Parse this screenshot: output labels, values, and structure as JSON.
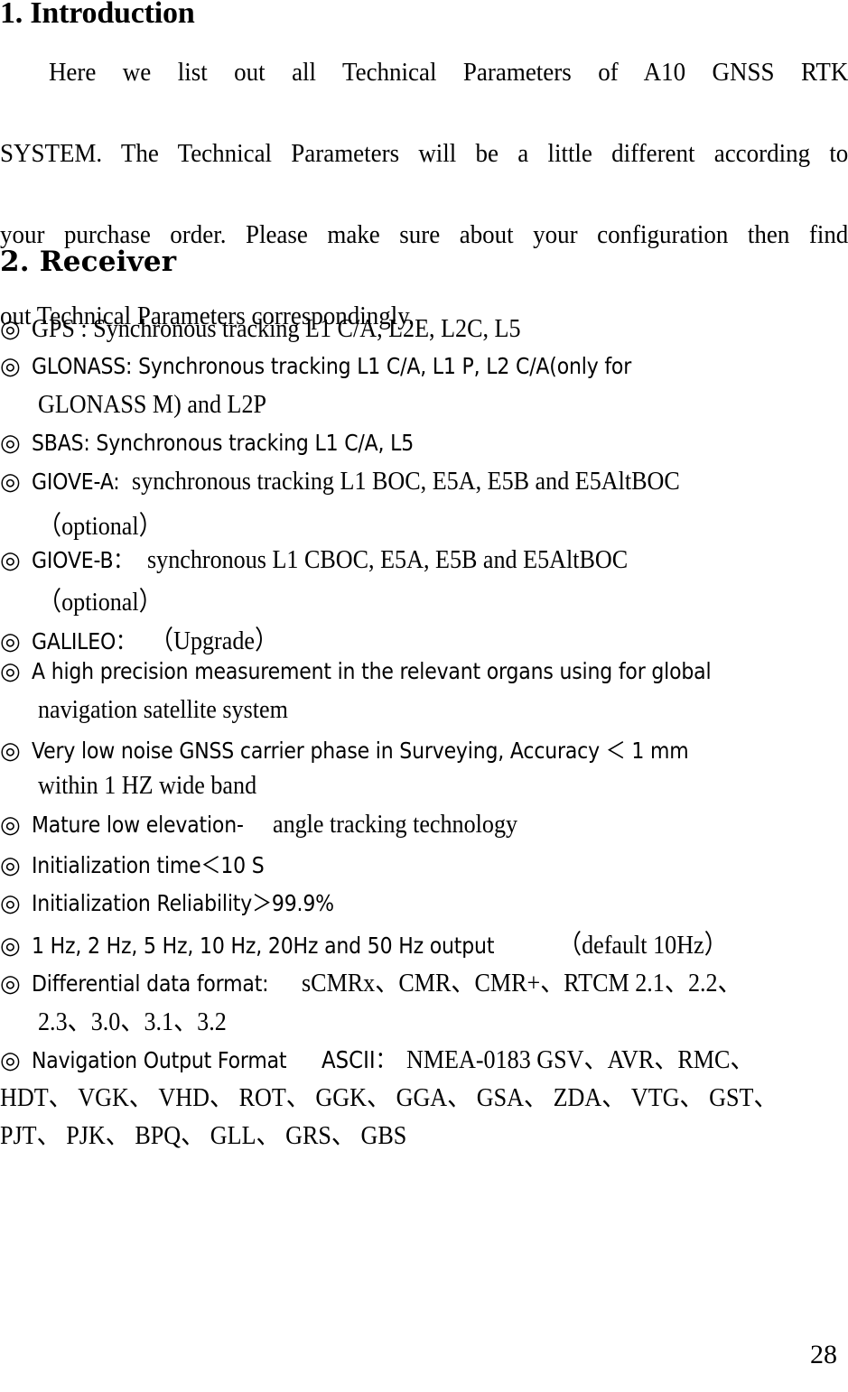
{
  "document": {
    "page_number": "28",
    "sections": [
      {
        "heading": "1. Introduction",
        "paragraph": "Here we list out all Technical Parameters of A10 GNSS RTK SYSTEM. The Technical Parameters will be a little different according to your purchase order. Please make sure about your configuration then find out Technical Parameters correspondingly.",
        "paragraph_lines": [
          "Here we list out all Technical Parameters of A10 GNSS RTK",
          "SYSTEM. The Technical Parameters will be a little different according to",
          "your purchase order. Please make sure about your configuration then find",
          "out Technical Parameters correspondingly."
        ]
      },
      {
        "heading": "2. Receiver",
        "bullet_symbol": "◎",
        "items": [
          {
            "id": "gps",
            "text": "GPS : Synchronous tracking L1 C/A, L2E, L2C, L5",
            "lines": [
              {
                "runs": [
                  {
                    "t": "◎",
                    "f": "bullet"
                  },
                  {
                    "t": "GPS : Synchronous tracking L1 C/A, L2E, L2C, L5",
                    "f": "serif"
                  }
                ]
              }
            ]
          },
          {
            "id": "glonass",
            "text": "GLONASS: Synchronous tracking L1 C/A, L1 P, L2 C/A(only for GLONASS M) and L2P",
            "lines": [
              {
                "runs": [
                  {
                    "t": "◎",
                    "f": "bullet"
                  },
                  {
                    "t": "GLONASS:  Synchronous  tracking  L1  C/A,  L1  P,  L2  C/A(only  for",
                    "f": "gothic"
                  }
                ]
              },
              {
                "runs": [
                  {
                    "t": "GLONASS M) and L2P",
                    "f": "serif"
                  }
                ],
                "indent": true
              }
            ]
          },
          {
            "id": "sbas",
            "text": "SBAS:  Synchronous tracking L1 C/A, L5",
            "lines": [
              {
                "runs": [
                  {
                    "t": "◎",
                    "f": "bullet"
                  },
                  {
                    "t": "SBAS:   Synchronous tracking L1 C/A, L5",
                    "f": "gothic"
                  }
                ]
              }
            ]
          },
          {
            "id": "giove-a",
            "text": "GIOVE-A: synchronous tracking  L1 BOC, E5A, E5B and E5AltBOC （optional）",
            "lines": [
              {
                "runs": [
                  {
                    "t": "◎",
                    "f": "bullet"
                  },
                  {
                    "t": "GIOVE-A:",
                    "f": "gothic"
                  },
                  {
                    "t": " synchronous tracking   L1 BOC, E5A, E5B and E5AltBOC",
                    "f": "serif"
                  }
                ]
              },
              {
                "runs": [
                  {
                    "t": "（optional）",
                    "f": "serif"
                  }
                ],
                "indent": true
              }
            ]
          },
          {
            "id": "giove-b",
            "text": "GIOVE-B： synchronous L1 CBOC, E5A, E5B and E5AltBOC （optional）",
            "lines": [
              {
                "runs": [
                  {
                    "t": "◎",
                    "f": "bullet"
                  },
                  {
                    "t": "GIOVE-B：",
                    "f": "gothic"
                  },
                  {
                    "t": "synchronous   L1   CBOC,   E5A,   E5B   and   E5AltBOC",
                    "f": "serif"
                  }
                ]
              },
              {
                "runs": [
                  {
                    "t": "（optional）",
                    "f": "serif"
                  }
                ],
                "indent": true
              }
            ]
          },
          {
            "id": "galileo",
            "text": "GALILEO：（Upgrade）",
            "lines": [
              {
                "runs": [
                  {
                    "t": "◎",
                    "f": "bullet"
                  },
                  {
                    "t": "GALILEO：",
                    "f": "gothic"
                  },
                  {
                    "t": "（Upgrade）",
                    "f": "serif"
                  }
                ]
              }
            ]
          },
          {
            "id": "high-precision",
            "text": "A high precision measurement in the relevant organs using for global navigation satellite system",
            "lines": [
              {
                "runs": [
                  {
                    "t": "◎",
                    "f": "bullet"
                  },
                  {
                    "t": "A  high precision measurement in the relevant organs using for global",
                    "f": "gothic"
                  }
                ]
              },
              {
                "runs": [
                  {
                    "t": "navigation satellite system",
                    "f": "serif"
                  }
                ],
                "indent": true
              }
            ]
          },
          {
            "id": "low-noise",
            "text": "Very low noise GNSS carrier phase in Surveying, Accuracy ＜ 1 mm within 1 HZ wide band",
            "lines": [
              {
                "runs": [
                  {
                    "t": "◎",
                    "f": "bullet"
                  },
                  {
                    "t": "Very low  noise  GNSS  carrier phase in Surveying,  Accuracy ＜ 1  mm",
                    "f": "gothic"
                  }
                ]
              },
              {
                "runs": [
                  {
                    "t": "within 1 HZ wide band",
                    "f": "serif"
                  }
                ],
                "indent": true
              }
            ]
          },
          {
            "id": "mature-tracking",
            "text": "Mature low elevation-angle tracking technology",
            "lines": [
              {
                "runs": [
                  {
                    "t": "◎",
                    "f": "bullet"
                  },
                  {
                    "t": "Mature low elevation-",
                    "f": "gothic"
                  },
                  {
                    "t": "angle tracking technology",
                    "f": "serif"
                  }
                ]
              }
            ]
          },
          {
            "id": "init-time",
            "text": "Initialization time＜10 S",
            "lines": [
              {
                "runs": [
                  {
                    "t": "◎",
                    "f": "bullet"
                  },
                  {
                    "t": "Initialization time＜10 S",
                    "f": "gothic"
                  }
                ]
              }
            ]
          },
          {
            "id": "init-reliability",
            "text": "Initialization Reliability＞99.9%",
            "lines": [
              {
                "runs": [
                  {
                    "t": "◎",
                    "f": "bullet"
                  },
                  {
                    "t": "Initialization Reliability＞99.9%",
                    "f": "gothic"
                  }
                ]
              }
            ]
          },
          {
            "id": "output-rate",
            "text": "1 Hz, 2 Hz, 5 Hz, 10 Hz, 20Hz and 50 Hz output （default 10Hz）",
            "lines": [
              {
                "runs": [
                  {
                    "t": "◎",
                    "f": "bullet"
                  },
                  {
                    "t": "1 Hz, 2 Hz, 5 Hz, 10 Hz, 20Hz and 50 Hz output",
                    "f": "gothic"
                  },
                  {
                    "t": "  （default 10Hz）",
                    "f": "serif"
                  }
                ]
              }
            ]
          },
          {
            "id": "differential-format",
            "text": "Differential data format: sCMRx、CMR、CMR+、RTCM 2.1、2.2、2.3、3.0、3.1、3.2",
            "lines": [
              {
                "runs": [
                  {
                    "t": "◎",
                    "f": "bullet"
                  },
                  {
                    "t": "Differential data format:",
                    "f": "gothic"
                  },
                  {
                    "t": "sCMRx、CMR、CMR+、RTCM 2.1、2.2、",
                    "f": "serif"
                  }
                ]
              },
              {
                "runs": [
                  {
                    "t": "2.3、3.0、3.1、3.2",
                    "f": "serif"
                  }
                ],
                "indent": true
              }
            ]
          },
          {
            "id": "navigation-output",
            "text": "Navigation Output Format  ASCII：NMEA-0183 GSV、AVR、RMC、HDT、VGK、VHD、ROT、GGK、GGA、GSA、ZDA、VTG、GST、PJT、PJK、BPQ、GLL、GRS、GBS",
            "lines": [
              {
                "runs": [
                  {
                    "t": "◎",
                    "f": "bullet"
                  },
                  {
                    "t": "Navigation Output Format",
                    "f": "gothic"
                  },
                  {
                    "t": "   ASCII：",
                    "f": "gothic2"
                  },
                  {
                    "t": "NMEA-0183 GSV、AVR、RMC、",
                    "f": "serif"
                  }
                ]
              },
              {
                "runs": [
                  {
                    "t": "HDT、 VGK、 VHD、 ROT、 GGK、 GGA、 GSA、 ZDA、 VTG、 GST、",
                    "f": "serif"
                  }
                ]
              },
              {
                "runs": [
                  {
                    "t": "PJT、 PJK、 BPQ、 GLL、 GRS、 GBS",
                    "f": "serif"
                  }
                ]
              }
            ]
          }
        ]
      }
    ]
  }
}
